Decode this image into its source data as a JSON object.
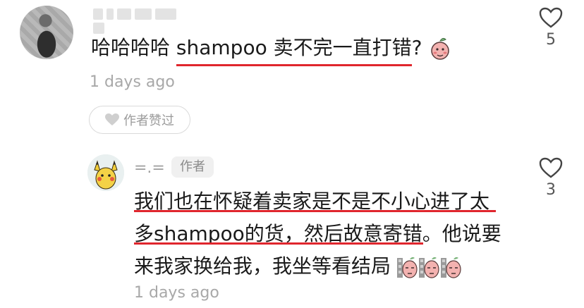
{
  "comment1": {
    "username_hidden": true,
    "text": "哈哈哈哈 shampoo 卖不完一直打错?",
    "time": "1 days ago",
    "liked_label": "作者赞过",
    "like_count": "5",
    "emoji": "embarrassed-peach-emoji"
  },
  "reply1": {
    "username": "=.=",
    "badge": "作者",
    "line1": "我们也在怀疑着卖家是不是不小心进了太",
    "line2": "多shampoo的货，然后故意寄错。他说要",
    "line3": "来我家换给我，我坐等看结局",
    "time": "1 days ago",
    "like_count": "3",
    "emoji": "peach-suspicious-emoji"
  },
  "colors": {
    "underline": "#e0262d",
    "meta": "#a8a8a8"
  }
}
